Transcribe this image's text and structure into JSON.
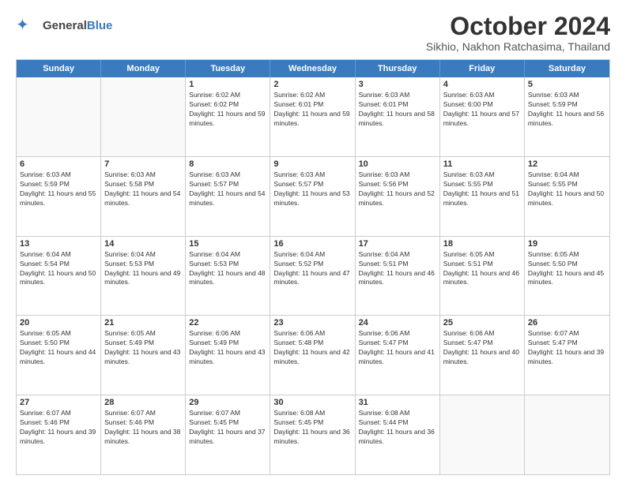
{
  "logo": {
    "general": "General",
    "blue": "Blue"
  },
  "title": "October 2024",
  "subtitle": "Sikhio, Nakhon Ratchasima, Thailand",
  "days": [
    "Sunday",
    "Monday",
    "Tuesday",
    "Wednesday",
    "Thursday",
    "Friday",
    "Saturday"
  ],
  "weeks": [
    [
      {
        "day": "",
        "info": ""
      },
      {
        "day": "",
        "info": ""
      },
      {
        "day": "1",
        "info": "Sunrise: 6:02 AM\nSunset: 6:02 PM\nDaylight: 11 hours and 59 minutes."
      },
      {
        "day": "2",
        "info": "Sunrise: 6:02 AM\nSunset: 6:01 PM\nDaylight: 11 hours and 59 minutes."
      },
      {
        "day": "3",
        "info": "Sunrise: 6:03 AM\nSunset: 6:01 PM\nDaylight: 11 hours and 58 minutes."
      },
      {
        "day": "4",
        "info": "Sunrise: 6:03 AM\nSunset: 6:00 PM\nDaylight: 11 hours and 57 minutes."
      },
      {
        "day": "5",
        "info": "Sunrise: 6:03 AM\nSunset: 5:59 PM\nDaylight: 11 hours and 56 minutes."
      }
    ],
    [
      {
        "day": "6",
        "info": "Sunrise: 6:03 AM\nSunset: 5:59 PM\nDaylight: 11 hours and 55 minutes."
      },
      {
        "day": "7",
        "info": "Sunrise: 6:03 AM\nSunset: 5:58 PM\nDaylight: 11 hours and 54 minutes."
      },
      {
        "day": "8",
        "info": "Sunrise: 6:03 AM\nSunset: 5:57 PM\nDaylight: 11 hours and 54 minutes."
      },
      {
        "day": "9",
        "info": "Sunrise: 6:03 AM\nSunset: 5:57 PM\nDaylight: 11 hours and 53 minutes."
      },
      {
        "day": "10",
        "info": "Sunrise: 6:03 AM\nSunset: 5:56 PM\nDaylight: 11 hours and 52 minutes."
      },
      {
        "day": "11",
        "info": "Sunrise: 6:03 AM\nSunset: 5:55 PM\nDaylight: 11 hours and 51 minutes."
      },
      {
        "day": "12",
        "info": "Sunrise: 6:04 AM\nSunset: 5:55 PM\nDaylight: 11 hours and 50 minutes."
      }
    ],
    [
      {
        "day": "13",
        "info": "Sunrise: 6:04 AM\nSunset: 5:54 PM\nDaylight: 11 hours and 50 minutes."
      },
      {
        "day": "14",
        "info": "Sunrise: 6:04 AM\nSunset: 5:53 PM\nDaylight: 11 hours and 49 minutes."
      },
      {
        "day": "15",
        "info": "Sunrise: 6:04 AM\nSunset: 5:53 PM\nDaylight: 11 hours and 48 minutes."
      },
      {
        "day": "16",
        "info": "Sunrise: 6:04 AM\nSunset: 5:52 PM\nDaylight: 11 hours and 47 minutes."
      },
      {
        "day": "17",
        "info": "Sunrise: 6:04 AM\nSunset: 5:51 PM\nDaylight: 11 hours and 46 minutes."
      },
      {
        "day": "18",
        "info": "Sunrise: 6:05 AM\nSunset: 5:51 PM\nDaylight: 11 hours and 46 minutes."
      },
      {
        "day": "19",
        "info": "Sunrise: 6:05 AM\nSunset: 5:50 PM\nDaylight: 11 hours and 45 minutes."
      }
    ],
    [
      {
        "day": "20",
        "info": "Sunrise: 6:05 AM\nSunset: 5:50 PM\nDaylight: 11 hours and 44 minutes."
      },
      {
        "day": "21",
        "info": "Sunrise: 6:05 AM\nSunset: 5:49 PM\nDaylight: 11 hours and 43 minutes."
      },
      {
        "day": "22",
        "info": "Sunrise: 6:06 AM\nSunset: 5:49 PM\nDaylight: 11 hours and 43 minutes."
      },
      {
        "day": "23",
        "info": "Sunrise: 6:06 AM\nSunset: 5:48 PM\nDaylight: 11 hours and 42 minutes."
      },
      {
        "day": "24",
        "info": "Sunrise: 6:06 AM\nSunset: 5:47 PM\nDaylight: 11 hours and 41 minutes."
      },
      {
        "day": "25",
        "info": "Sunrise: 6:06 AM\nSunset: 5:47 PM\nDaylight: 11 hours and 40 minutes."
      },
      {
        "day": "26",
        "info": "Sunrise: 6:07 AM\nSunset: 5:47 PM\nDaylight: 11 hours and 39 minutes."
      }
    ],
    [
      {
        "day": "27",
        "info": "Sunrise: 6:07 AM\nSunset: 5:46 PM\nDaylight: 11 hours and 39 minutes."
      },
      {
        "day": "28",
        "info": "Sunrise: 6:07 AM\nSunset: 5:46 PM\nDaylight: 11 hours and 38 minutes."
      },
      {
        "day": "29",
        "info": "Sunrise: 6:07 AM\nSunset: 5:45 PM\nDaylight: 11 hours and 37 minutes."
      },
      {
        "day": "30",
        "info": "Sunrise: 6:08 AM\nSunset: 5:45 PM\nDaylight: 11 hours and 36 minutes."
      },
      {
        "day": "31",
        "info": "Sunrise: 6:08 AM\nSunset: 5:44 PM\nDaylight: 11 hours and 36 minutes."
      },
      {
        "day": "",
        "info": ""
      },
      {
        "day": "",
        "info": ""
      }
    ]
  ]
}
